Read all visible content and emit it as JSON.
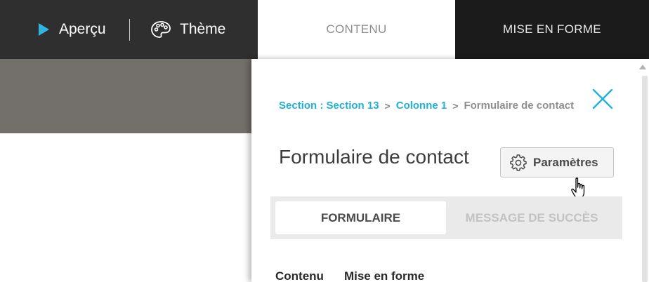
{
  "toolbar": {
    "preview_label": "Aperçu",
    "theme_label": "Thème",
    "preview_icon": "play-icon",
    "theme_icon": "palette-icon",
    "accent_color": "#1fb2d8"
  },
  "top_tabs": [
    {
      "label": "CONTENU",
      "active": true
    },
    {
      "label": "MISE EN FORME",
      "active": false
    }
  ],
  "panel": {
    "breadcrumb": [
      {
        "label": "Section : Section 13",
        "link": true
      },
      {
        "label": "Colonne 1",
        "link": true
      },
      {
        "label": "Formulaire de contact",
        "link": false
      }
    ],
    "breadcrumb_separator": ">",
    "close_icon": "close-icon",
    "title": "Formulaire de contact",
    "settings_button": {
      "label": "Paramètres",
      "icon": "gear-icon"
    },
    "tabs": [
      {
        "label": "FORMULAIRE",
        "active": true
      },
      {
        "label": "MESSAGE DE SUCCÈS",
        "active": false
      }
    ],
    "subtabs": [
      {
        "label": "Contenu"
      },
      {
        "label": "Mise en forme"
      }
    ]
  }
}
